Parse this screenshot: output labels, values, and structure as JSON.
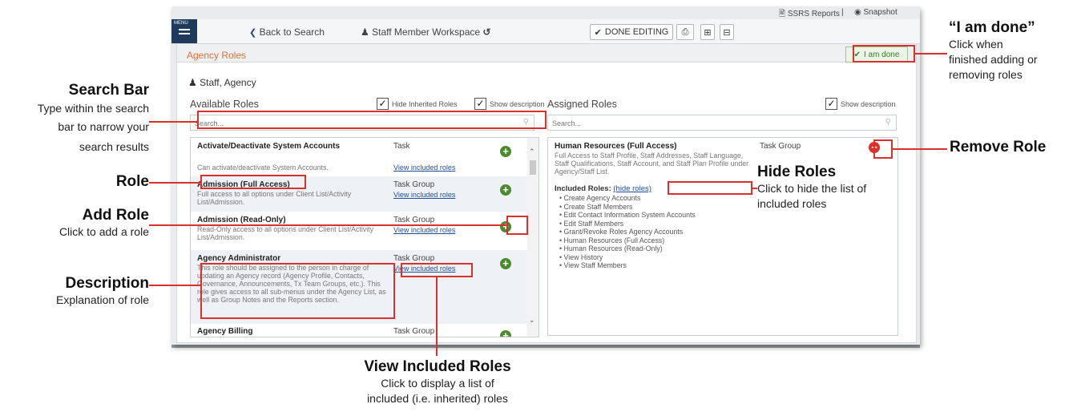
{
  "app": {
    "topbar": {
      "reports": "SSRS Reports",
      "separator": "|",
      "snapshot": "Snapshot"
    },
    "nav": {
      "menu_label": "MENU",
      "back": "Back to Search",
      "workspace": "Staff Member Workspace",
      "done_editing": "DONE EDITING"
    },
    "panel": {
      "title": "Agency Roles",
      "i_am_done": "I am done",
      "person": "Staff, Agency"
    },
    "available": {
      "heading": "Available Roles",
      "hide_inherited_label": "Hide Inherited Roles",
      "hide_inherited_checked": true,
      "show_description_label": "Show description",
      "show_description_checked": true,
      "search_placeholder": "Search...",
      "view_link": "View included roles",
      "roles": [
        {
          "name": "Activate/Deactivate System Accounts",
          "type": "Task",
          "desc": "Can activate/deactivate System Accounts."
        },
        {
          "name": "Admission (Full Access)",
          "type": "Task Group",
          "desc": "Full access to all options under Client List/Activity List/Admission."
        },
        {
          "name": "Admission (Read-Only)",
          "type": "Task Group",
          "desc": "Read-Only access to all options under Client List/Activity List/Admission."
        },
        {
          "name": "Agency Administrator",
          "type": "Task Group",
          "desc": "This role should be assigned to the person in charge of updating an Agency record (Agency Profile, Contacts, Governance, Announcements, Tx Team Groups, etc.). This role gives access to all sub-menus under the Agency List, as well as Group Notes and the Reports section."
        },
        {
          "name": "Agency Billing",
          "type": "Task Group",
          "desc": ""
        }
      ]
    },
    "assigned": {
      "heading": "Assigned Roles",
      "show_description_label": "Show description",
      "show_description_checked": true,
      "search_placeholder": "Search...",
      "role": {
        "name": "Human Resources (Full Access)",
        "type": "Task Group",
        "desc": "Full Access to Staff Profile, Staff Addresses, Staff Language, Staff Qualifications, Staff Account, and Staff Plan Profile under Agency/Staff List.",
        "included_label": "Included Roles:",
        "hide_link": "(hide roles)",
        "included": [
          "Create Agency Accounts",
          "Create Staff Members",
          "Edit Contact Information System Accounts",
          "Edit Staff Members",
          "Grant/Revoke Roles Agency Accounts",
          "Human Resources (Full Access)",
          "Human Resources (Read-Only)",
          "View History",
          "View Staff Members"
        ]
      }
    }
  },
  "annotations": {
    "search_bar": {
      "title": "Search Bar",
      "lines": [
        "Type within the search",
        "bar to narrow your",
        "search results"
      ]
    },
    "role": {
      "title": "Role"
    },
    "add_role": {
      "title": "Add Role",
      "lines": [
        "Click to add a role"
      ]
    },
    "description": {
      "title": "Description",
      "lines": [
        "Explanation of role"
      ]
    },
    "view_included": {
      "title": "View Included Roles",
      "lines": [
        "Click to display a list of",
        "included (i.e. inherited) roles"
      ]
    },
    "i_am_done": {
      "title": "“I am done”",
      "lines": [
        "Click when",
        "finished adding or",
        "removing roles"
      ]
    },
    "remove_role": {
      "title": "Remove Role"
    },
    "hide_roles": {
      "title": "Hide Roles",
      "lines": [
        "Click to hide the list of",
        "included roles"
      ]
    }
  },
  "colors": {
    "highlight": "#d9312b",
    "accent_orange": "#e0703a",
    "add_green": "#4b8a2e",
    "remove_red": "#d9312b",
    "menu_navy": "#1f3b5c"
  },
  "icons": [
    "document-icon",
    "eye-icon",
    "back-arrow-icon",
    "user-icon",
    "refresh-icon",
    "check-icon",
    "print-icon",
    "expand-icon",
    "collapse-icon",
    "search-icon",
    "plus-circle-icon",
    "minus-circle-icon",
    "scroll-up-icon",
    "scroll-down-icon"
  ]
}
